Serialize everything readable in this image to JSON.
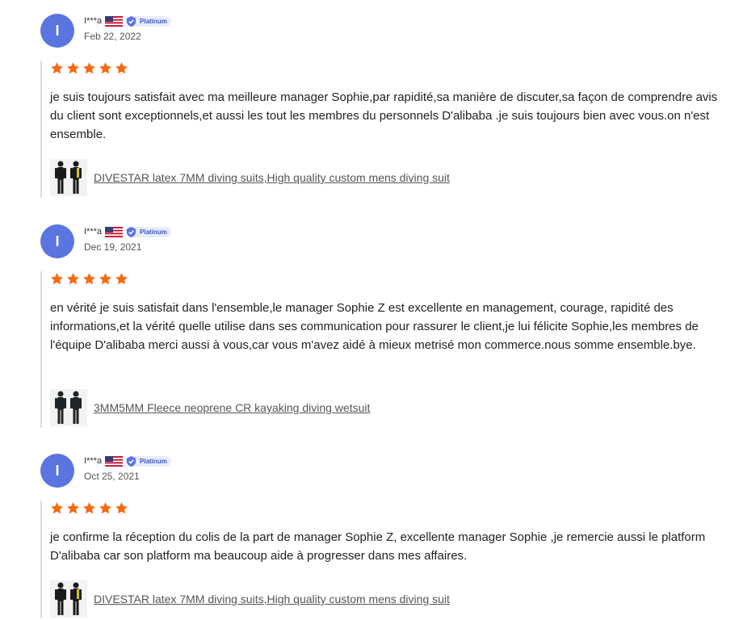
{
  "reviews": [
    {
      "avatar_letter": "I",
      "username": "I***a",
      "badge": "Platinum",
      "date": "Feb 22, 2022",
      "rating": 5,
      "text": "je suis toujours satisfait avec ma meilleure manager Sophie,par rapidité,sa manière de discuter,sa façon de comprendre avis du client sont exceptionnels,et aussi les tout les membres du personnels D'alibaba .je suis toujours bien avec vous.on n'est ensemble.",
      "product": "DIVESTAR latex 7MM diving suits,High quality custom mens diving suit"
    },
    {
      "avatar_letter": "I",
      "username": "I***a",
      "badge": "Platinum",
      "date": "Dec 19, 2021",
      "rating": 5,
      "text": "en vérité je suis satisfait dans l'ensemble,le manager Sophie Z est excellente en management, courage, rapidité des informations,et la vérité quelle utilise dans ses communication pour rassurer le client,je lui félicite Sophie,les membres de l'équipe D'alibaba merci aussi à vous,car vous m'avez aidé à mieux metrisé mon commerce.nous somme ensemble.bye.",
      "product": "3MM5MM Fleece neoprene CR kayaking diving wetsuit"
    },
    {
      "avatar_letter": "I",
      "username": "I***a",
      "badge": "Platinum",
      "date": "Oct 25, 2021",
      "rating": 5,
      "text": "je confirme la réception du colis de la part de manager Sophie Z, excellente manager Sophie ,je remercie aussi le platform D'alibaba car son platform ma beaucoup aide à progresser dans mes affaires.",
      "product": "DIVESTAR latex 7MM diving suits,High quality custom mens diving suit"
    }
  ],
  "colors": {
    "avatar": "#5a74e0",
    "star": "#f56a14",
    "badge": "#3b57c4"
  },
  "icons": {
    "flag": "us-flag-icon",
    "badge": "shield-check-icon",
    "star": "star-icon"
  }
}
